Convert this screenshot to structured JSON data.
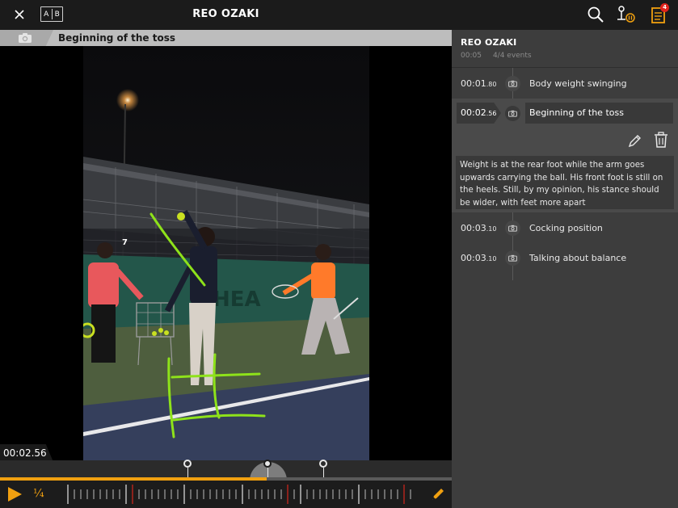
{
  "player": {
    "title": "REO OZAKI",
    "caption": "Beginning of the toss",
    "current_time": "00:02.56",
    "speed_label": "¼",
    "progress": 0.59,
    "shirt_number": "7"
  },
  "toolbar": {
    "close_icon": "close-icon",
    "ab_compare": {
      "a": "A",
      "b": "B"
    },
    "notification_count": "4"
  },
  "panel": {
    "name": "REO OZAKI",
    "duration": "00:05",
    "events_count": "4/4 events"
  },
  "events": [
    {
      "time_main": "00:01",
      "time_frac": ".80",
      "label": "Body weight swinging"
    },
    {
      "time_main": "00:02",
      "time_frac": ".56",
      "label": "Beginning of the toss",
      "selected": true
    },
    {
      "time_main": "00:03",
      "time_frac": ".10",
      "label": "Cocking position"
    },
    {
      "time_main": "00:03",
      "time_frac": ".10",
      "label": "Talking about balance"
    }
  ],
  "selected_note": "Weight is at the rear foot while the arm goes upwards carrying the ball. His front foot is still on the heels. Still, by my opinion, his stance should be wider, with feet more apart",
  "colors": {
    "accent": "#f0a010",
    "drawing": "#8ee21a",
    "badge": "#e0231c",
    "panel_bg": "#3d3d3d",
    "court_green": "#4e5e3e",
    "court_blue": "#353f5c"
  }
}
